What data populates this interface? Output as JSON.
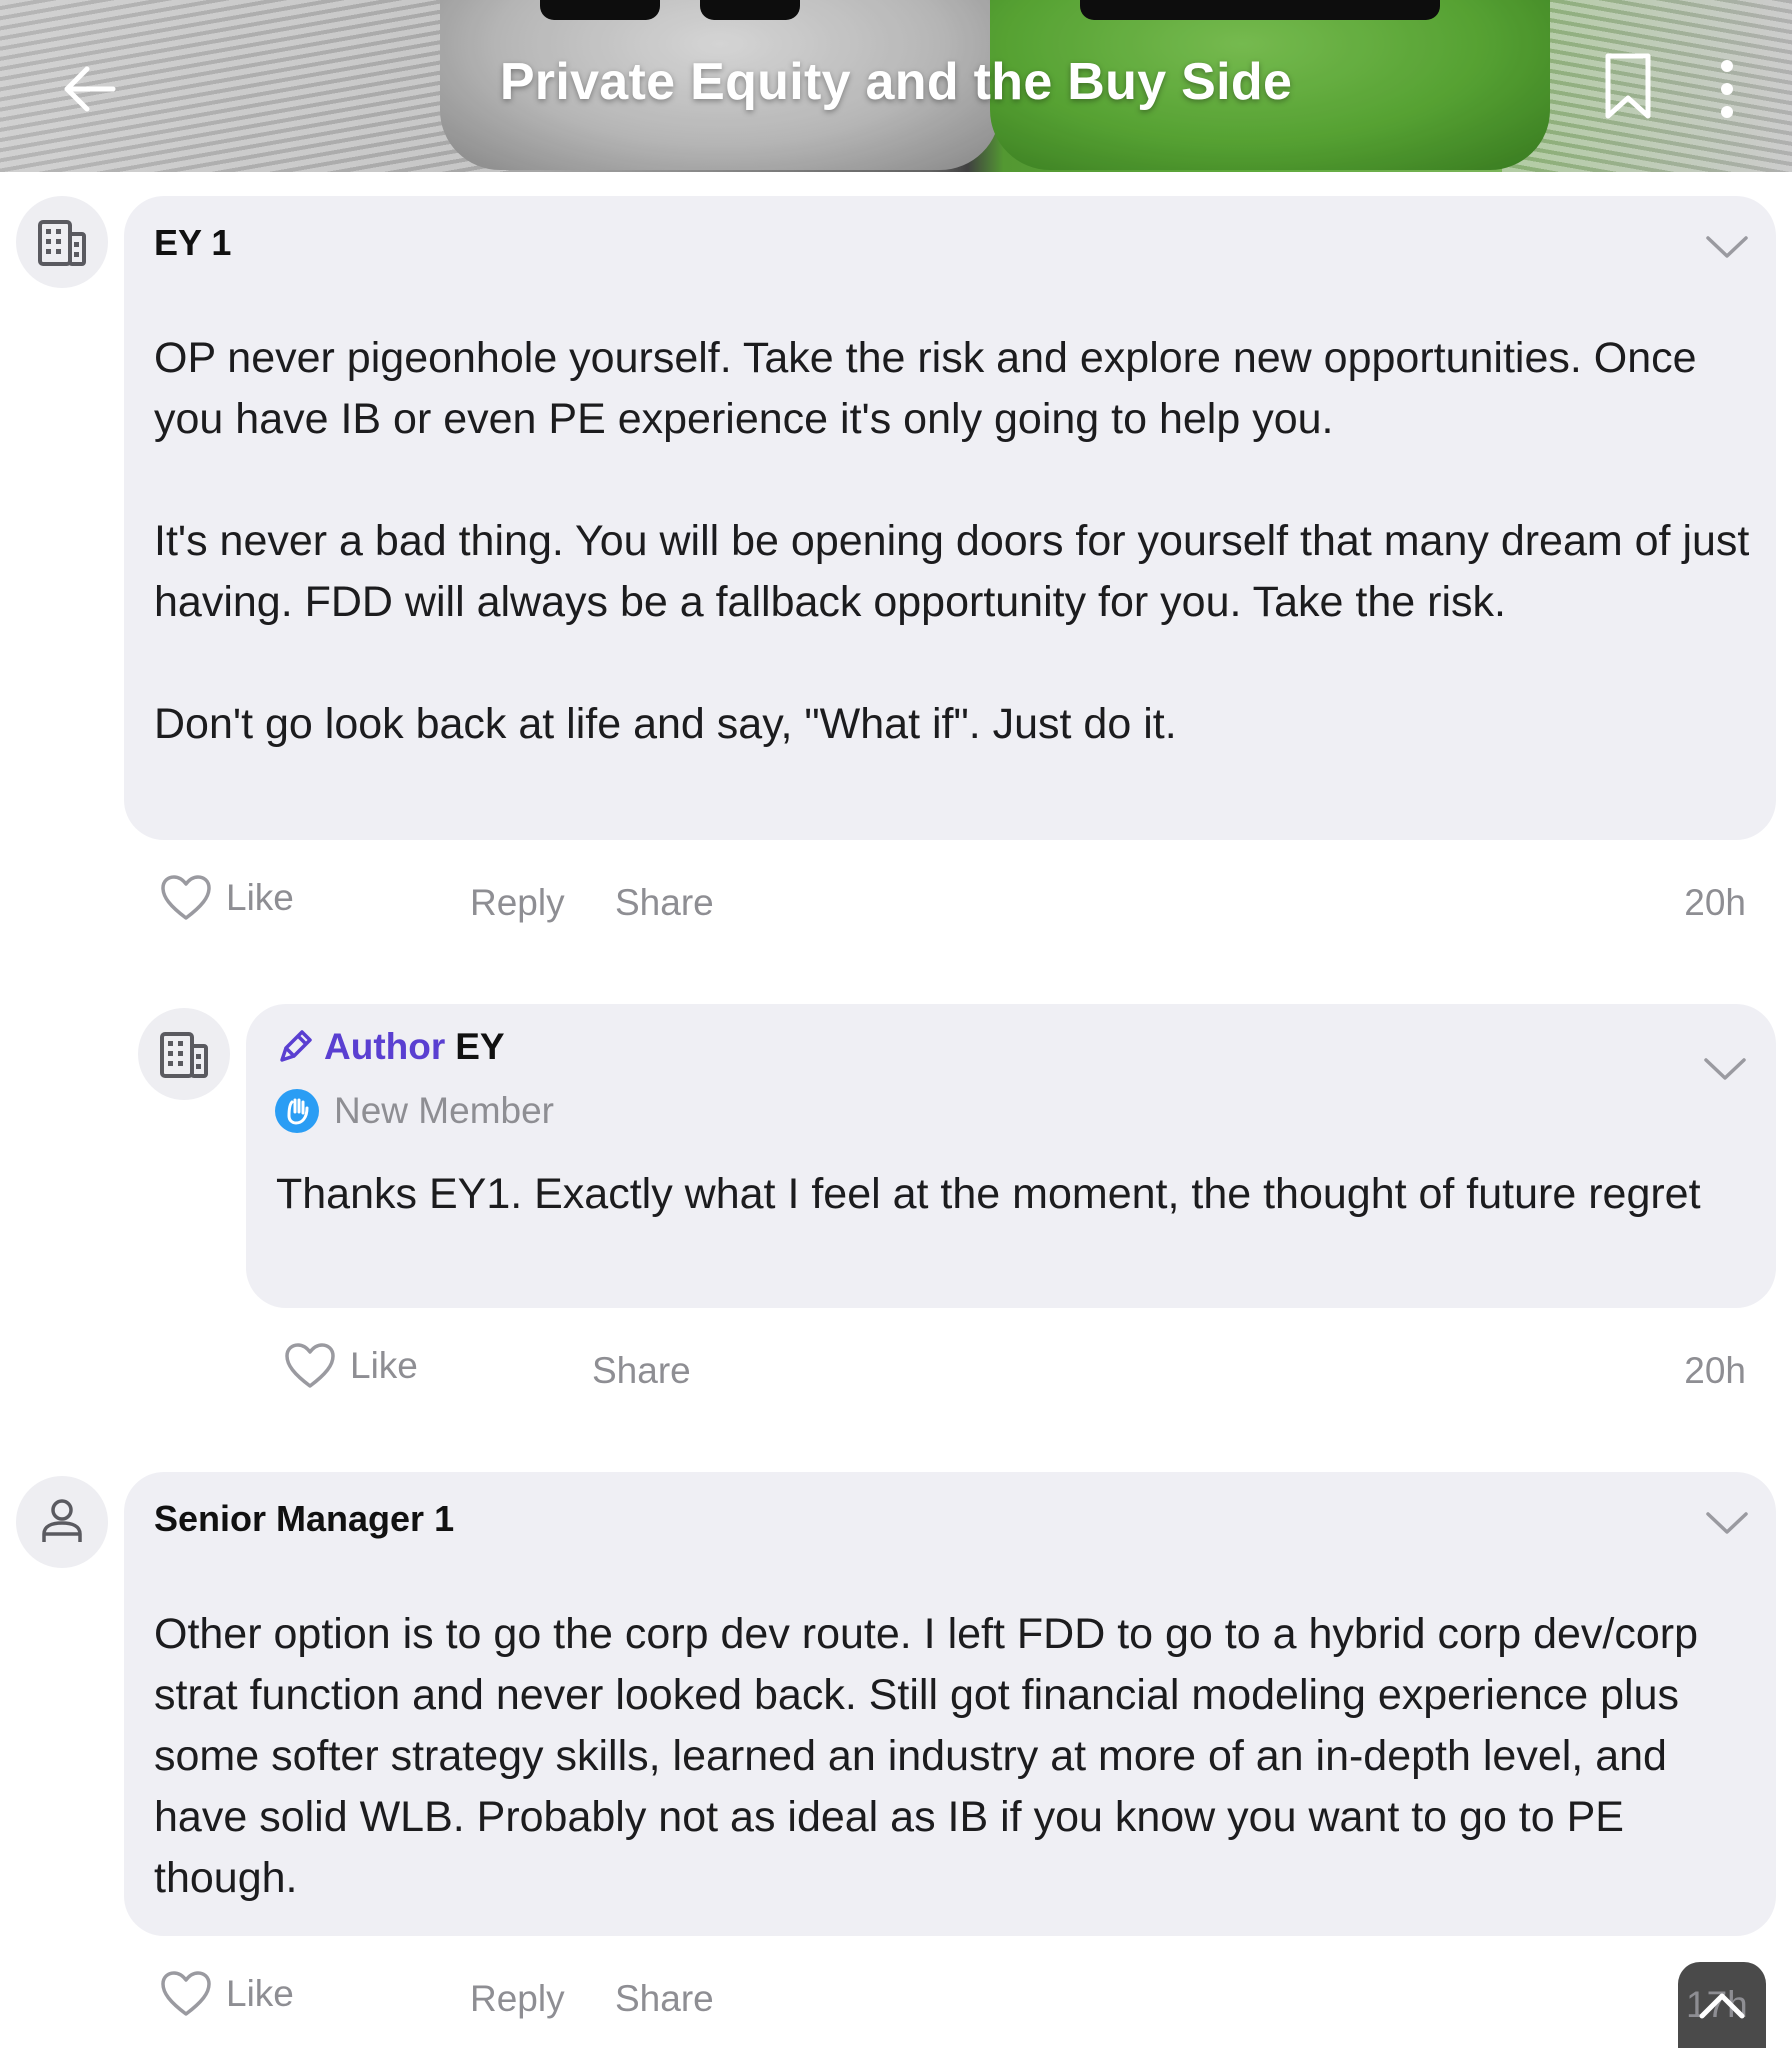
{
  "header": {
    "title": "Private Equity and the Buy Side",
    "back_icon": "arrow-left-icon",
    "bookmark_icon": "bookmark-icon",
    "more_icon": "more-vertical-icon"
  },
  "comments": [
    {
      "author": "EY 1",
      "avatar_icon": "building-icon",
      "paragraphs": [
        "OP never pigeonhole yourself. Take the risk and explore new opportunities. Once you have IB or even PE experience it's only going to help you.",
        "It's never a bad thing. You will be opening doors for yourself that many dream of just having. FDD will always be a fallback opportunity for you. Take the risk.",
        "Don't go look back at life and say, \"What if\". Just do it."
      ],
      "actions": {
        "like": "Like",
        "reply": "Reply",
        "share": "Share"
      },
      "time": "20h"
    },
    {
      "author_tag": "Author",
      "author": "EY",
      "badge": "New Member",
      "avatar_icon": "building-icon",
      "body": "Thanks EY1. Exactly what I feel at the moment, the thought of future regret",
      "actions": {
        "like": "Like",
        "share": "Share"
      },
      "time": "20h"
    },
    {
      "author": "Senior Manager 1",
      "avatar_icon": "person-icon",
      "body": "Other option is to go the corp dev route. I left FDD to go to a hybrid corp dev/corp strat function and never looked back. Still got financial modeling experience plus some softer strategy skills, learned an industry at more of an in-depth level, and have solid WLB. Probably not as ideal as IB if you know you want to go to PE though.",
      "actions": {
        "like": "Like",
        "reply": "Reply",
        "share": "Share"
      },
      "time": "17h"
    }
  ],
  "colors": {
    "bubble": "#efeff4",
    "muted": "#8e8e93",
    "author_accent": "#5a3fd1",
    "badge_blue": "#2a9df4"
  }
}
